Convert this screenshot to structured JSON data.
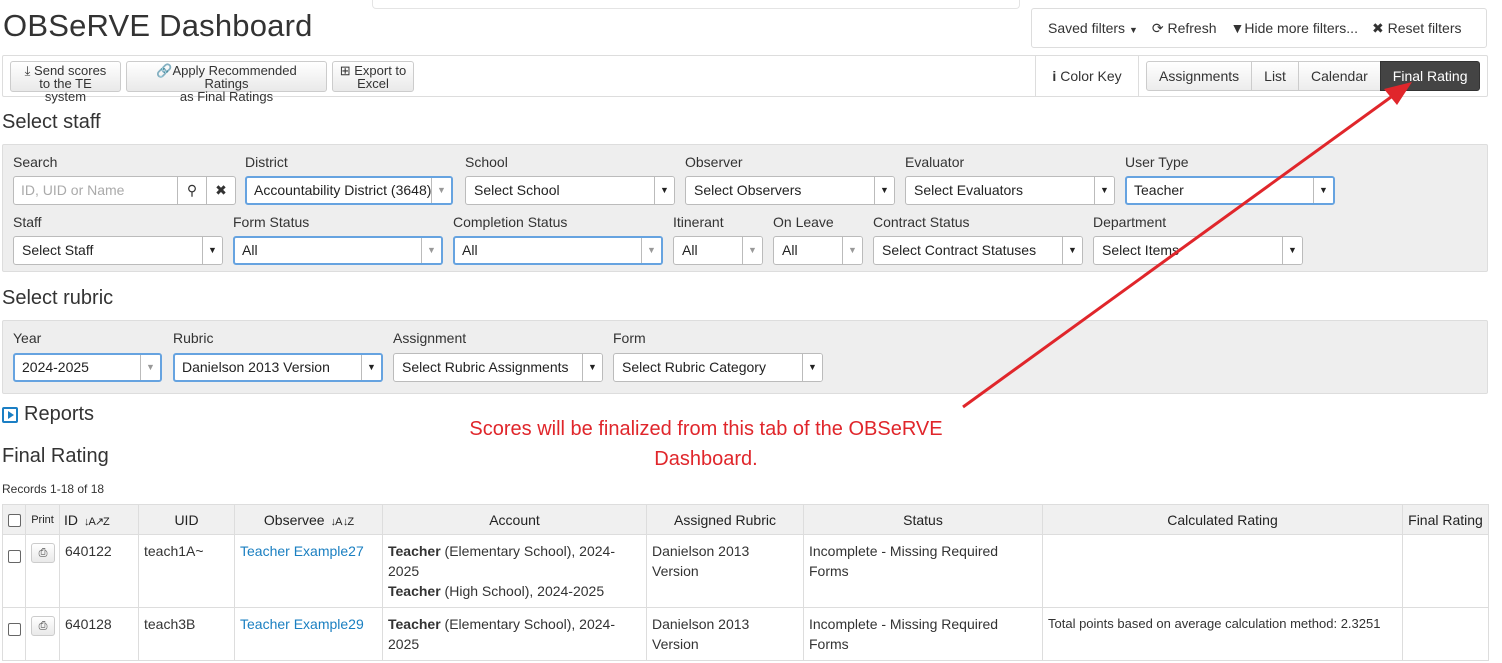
{
  "app": {
    "title": "OBSeRVE Dashboard"
  },
  "filterbar": {
    "saved_filters": "Saved filters",
    "refresh": "Refresh",
    "hide_more": "Hide more filters...",
    "reset": "Reset filters"
  },
  "actions": {
    "send_scores_l1": "Send scores",
    "send_scores_l2": "to the TE system",
    "apply_l1": "Apply Recommended Ratings",
    "apply_l2": "as Final Ratings",
    "export_l1": "Export to",
    "export_l2": "Excel",
    "color_key": "Color Key"
  },
  "view_tabs": [
    {
      "label": "Assignments"
    },
    {
      "label": "List"
    },
    {
      "label": "Calendar"
    },
    {
      "label": "Final Rating",
      "active": true
    }
  ],
  "select_staff": {
    "heading": "Select staff",
    "search_label": "Search",
    "search_placeholder": "ID, UID or Name",
    "district_label": "District",
    "district_value": "Accountability District (3648)",
    "school_label": "School",
    "school_value": "Select School",
    "observer_label": "Observer",
    "observer_value": "Select Observers",
    "evaluator_label": "Evaluator",
    "evaluator_value": "Select Evaluators",
    "usertype_label": "User Type",
    "usertype_value": "Teacher",
    "staff_label": "Staff",
    "staff_value": "Select Staff",
    "formstatus_label": "Form Status",
    "formstatus_value": "All",
    "completion_label": "Completion Status",
    "completion_value": "All",
    "itinerant_label": "Itinerant",
    "itinerant_value": "All",
    "onleave_label": "On Leave",
    "onleave_value": "All",
    "contract_label": "Contract Status",
    "contract_value": "Select Contract Statuses",
    "department_label": "Department",
    "department_value": "Select Items"
  },
  "select_rubric": {
    "heading": "Select rubric",
    "year_label": "Year",
    "year_value": "2024-2025",
    "rubric_label": "Rubric",
    "rubric_value": "Danielson 2013 Version",
    "assignment_label": "Assignment",
    "assignment_value": "Select Rubric Assignments",
    "form_label": "Form",
    "form_value": "Select Rubric Category"
  },
  "reports": {
    "label": "Reports"
  },
  "annotation": {
    "line1": "Scores will be finalized from this tab of the OBSeRVE",
    "line2": "Dashboard."
  },
  "final_rating": {
    "heading": "Final Rating",
    "records": "Records 1-18 of 18",
    "columns": {
      "print": "Print",
      "id": "ID",
      "uid": "UID",
      "observee": "Observee",
      "account": "Account",
      "assigned_rubric": "Assigned Rubric",
      "status": "Status",
      "calculated_rating": "Calculated Rating",
      "final_rating": "Final Rating"
    },
    "rows": [
      {
        "id": "640122",
        "uid": "teach1A~",
        "observee": "Teacher Example27",
        "acc1_role": "Teacher",
        "acc1_rest": " (Elementary School), 2024-2025",
        "acc2_role": "Teacher",
        "acc2_rest": " (High School), 2024-2025",
        "rubric": "Danielson 2013 Version",
        "status": "Incomplete - Missing Required Forms",
        "calculated": ""
      },
      {
        "id": "640128",
        "uid": "teach3B",
        "observee": "Teacher Example29",
        "acc1_role": "Teacher",
        "acc1_rest": " (Elementary School), 2024-2025",
        "rubric": "Danielson 2013 Version",
        "status": "Incomplete - Missing Required Forms",
        "calculated": "Total points based on average calculation method: 2.3251"
      }
    ]
  },
  "colors": {
    "accent": "#1a7fc1",
    "annotation": "#e0262b",
    "active_tab": "#444444"
  }
}
